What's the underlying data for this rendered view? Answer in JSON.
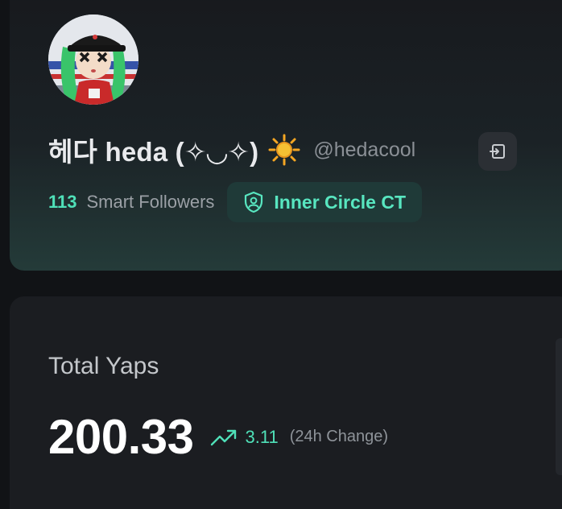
{
  "profile": {
    "display_name": "헤다 heda (✧◡✧)",
    "handle": "@hedacool",
    "smart_followers_count": "113",
    "smart_followers_label": "Smart Followers",
    "badge_label": "Inner Circle CT",
    "icons": {
      "status": "sun-icon",
      "link": "external-link-icon",
      "badge": "shield-user-icon"
    }
  },
  "yaps": {
    "title": "Total Yaps",
    "value": "200.33",
    "change_value": "3.11",
    "change_label": "(24h Change)",
    "icon": "trending-up-icon"
  },
  "colors": {
    "accent": "#4fe0b8",
    "background": "#111316",
    "card": "#1b1d21"
  }
}
